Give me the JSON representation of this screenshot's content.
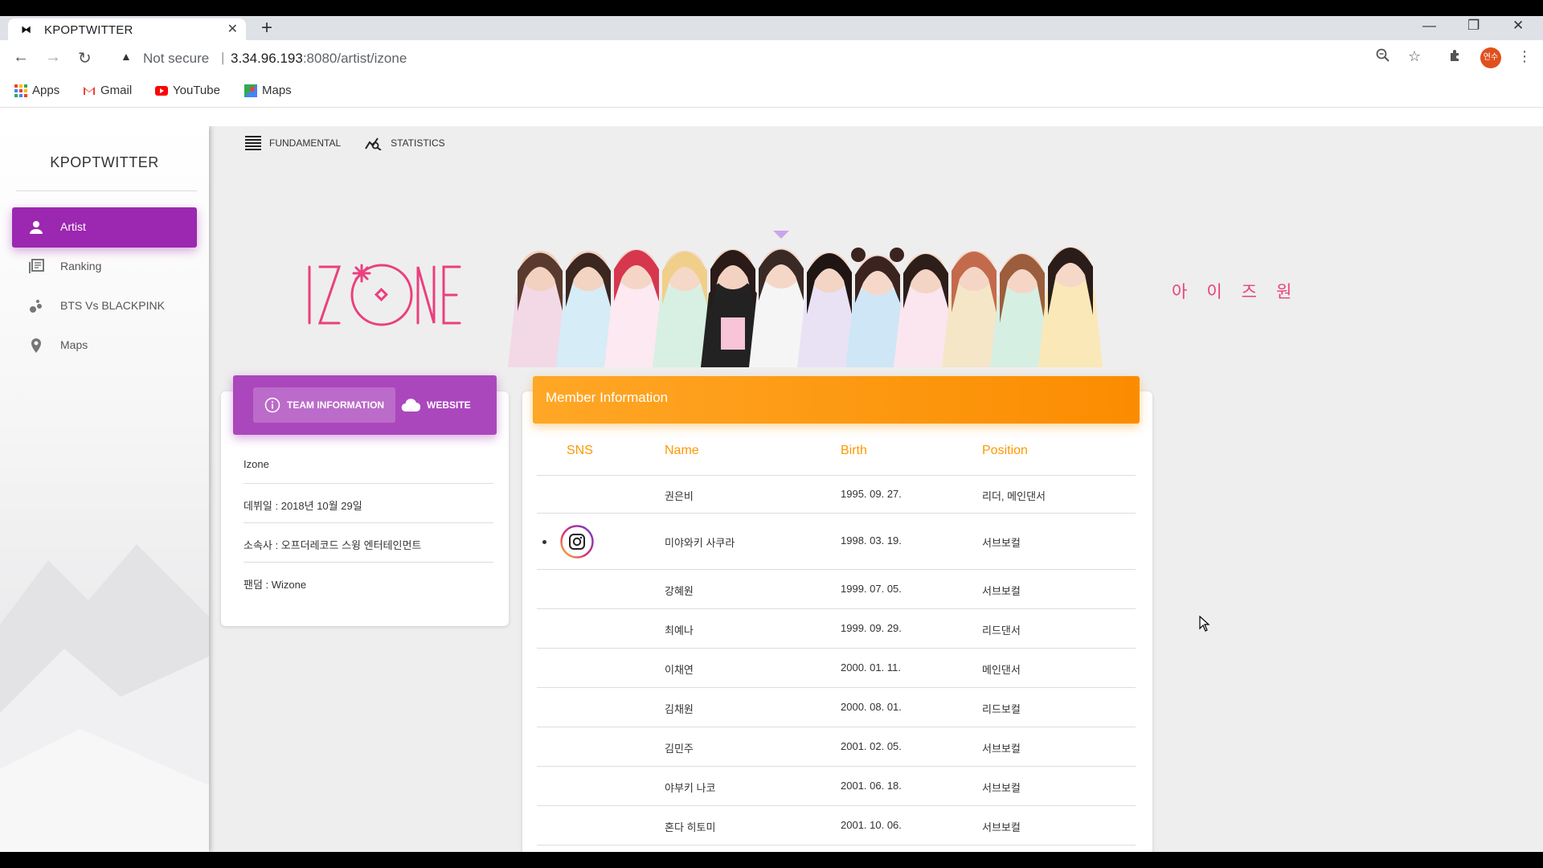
{
  "browser": {
    "tab_title": "KPOPTWITTER",
    "not_secure_label": "Not secure",
    "url_host": "3.34.96.193",
    "url_rest": ":8080/artist/izone",
    "avatar_text": "연수",
    "bookmarks": [
      "Apps",
      "Gmail",
      "YouTube",
      "Maps"
    ]
  },
  "sidebar": {
    "brand": "KPOPTWITTER",
    "items": [
      {
        "label": "Artist",
        "icon": "person-icon",
        "active": true
      },
      {
        "label": "Ranking",
        "icon": "library-icon",
        "active": false
      },
      {
        "label": "BTS Vs BLACKPINK",
        "icon": "bubble-chart-icon",
        "active": false
      },
      {
        "label": "Maps",
        "icon": "location-pin-icon",
        "active": false
      }
    ]
  },
  "topnav": {
    "fundamental": "FUNDAMENTAL",
    "statistics": "STATISTICS"
  },
  "hero": {
    "logo_text": "IZ*ONE",
    "hangul": "아이즈원"
  },
  "team": {
    "tab_info": "TEAM INFORMATION",
    "tab_website": "WEBSITE",
    "rows": [
      "Izone",
      "데뷔일 : 2018년 10월 29일",
      "소속사 : 오프더레코드 스윙 엔터테인먼트",
      "팬덤 : Wizone"
    ]
  },
  "members": {
    "title": "Member Information",
    "headers": [
      "SNS",
      "Name",
      "Birth",
      "Position"
    ],
    "rows": [
      {
        "sns": false,
        "name": "권은비",
        "birth": "1995. 09. 27.",
        "position": "리더, 메인댄서"
      },
      {
        "sns": true,
        "name": "미야와키 사쿠라",
        "birth": "1998. 03. 19.",
        "position": "서브보컬"
      },
      {
        "sns": false,
        "name": "강혜원",
        "birth": "1999. 07. 05.",
        "position": "서브보컬"
      },
      {
        "sns": false,
        "name": "최예나",
        "birth": "1999. 09. 29.",
        "position": "리드댄서"
      },
      {
        "sns": false,
        "name": "이채연",
        "birth": "2000. 01. 11.",
        "position": "메인댄서"
      },
      {
        "sns": false,
        "name": "김채원",
        "birth": "2000. 08. 01.",
        "position": "리드보컬"
      },
      {
        "sns": false,
        "name": "김민주",
        "birth": "2001. 02. 05.",
        "position": "서브보컬"
      },
      {
        "sns": false,
        "name": "야부키 나코",
        "birth": "2001. 06. 18.",
        "position": "서브보컬"
      },
      {
        "sns": false,
        "name": "혼다 히토미",
        "birth": "2001. 10. 06.",
        "position": "서브보컬"
      }
    ]
  },
  "colors": {
    "accent_purple": "#9c27b0",
    "accent_orange": "#ff9800",
    "izone_pink": "#e9407e"
  }
}
